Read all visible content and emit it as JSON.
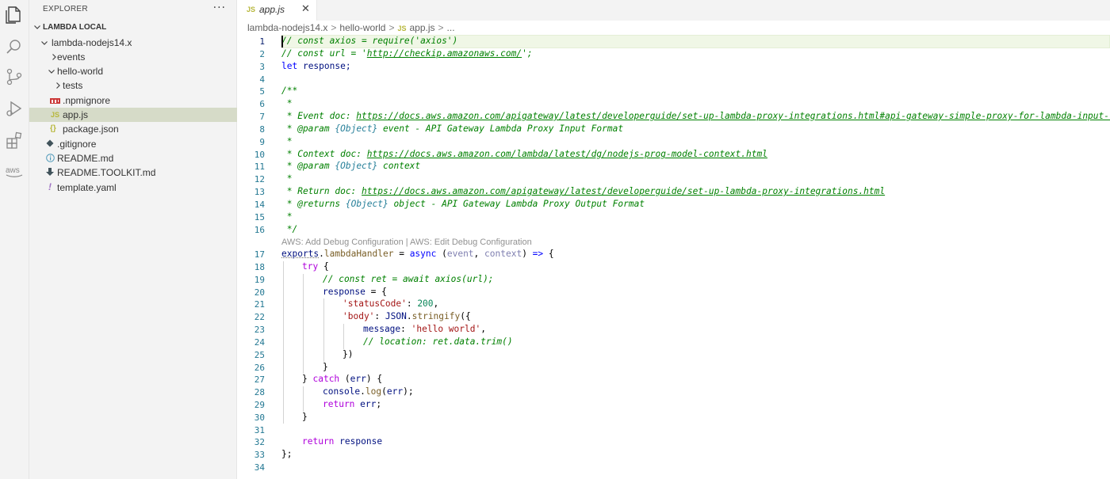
{
  "explorer": {
    "title": "EXPLORER",
    "more_label": "···",
    "section": "LAMBDA LOCAL",
    "tree": [
      {
        "label": "lambda-nodejs14.x",
        "kind": "folder-open"
      },
      {
        "label": "events",
        "kind": "folder-closed"
      },
      {
        "label": "hello-world",
        "kind": "folder-open"
      },
      {
        "label": "tests",
        "kind": "folder-closed"
      },
      {
        "label": ".npmignore",
        "kind": "file",
        "icon": "npm-icon"
      },
      {
        "label": "app.js",
        "kind": "file",
        "icon": "js-icon",
        "selected": true
      },
      {
        "label": "package.json",
        "kind": "file",
        "icon": "json-icon"
      },
      {
        "label": ".gitignore",
        "kind": "file",
        "icon": "git-icon"
      },
      {
        "label": "README.md",
        "kind": "file",
        "icon": "info-icon"
      },
      {
        "label": "README.TOOLKIT.md",
        "kind": "file",
        "icon": "download-icon"
      },
      {
        "label": "template.yaml",
        "kind": "file",
        "icon": "exclamation-icon"
      }
    ]
  },
  "tab": {
    "label": "app.js",
    "js_badge": "JS",
    "close": "✕"
  },
  "breadcrumb": {
    "items": [
      "lambda-nodejs14.x",
      "hello-world",
      "app.js",
      "..."
    ],
    "js_badge": "JS",
    "separator": ">"
  },
  "editor": {
    "line_numbers": [
      "1",
      "2",
      "3",
      "4",
      "5",
      "6",
      "7",
      "8",
      "9",
      "10",
      "11",
      "12",
      "13",
      "14",
      "15",
      "16",
      "17",
      "18",
      "19",
      "20",
      "21",
      "22",
      "23",
      "24",
      "25",
      "26",
      "27",
      "28",
      "29",
      "30",
      "31",
      "32",
      "33",
      "34"
    ],
    "codelens": "AWS: Add Debug Configuration | AWS: Edit Debug Configuration",
    "lines": {
      "l1": "// const axios = require('axios')",
      "l2a": "// const url = '",
      "l2url": "http://checkip.amazonaws.com/",
      "l2b": "';",
      "l3_kw": "let",
      "l3_rest": " response;",
      "l5": "/**",
      "l6": " *",
      "l7a": " * Event doc: ",
      "l7url": "https://docs.aws.amazon.com/apigateway/latest/developerguide/set-up-lambda-proxy-integrations.html#api-gateway-simple-proxy-for-lambda-input-format",
      "l8tag": " * @param",
      "l8type": "{Object}",
      "l8rest": " event - API Gateway Lambda Proxy Input Format",
      "l9": " *",
      "l10a": " * Context doc: ",
      "l10url": "https://docs.aws.amazon.com/lambda/latest/dg/nodejs-prog-model-context.html",
      "l11tag": " * @param",
      "l11type": "{Object}",
      "l11rest": " context",
      "l12": " *",
      "l13a": " * Return doc: ",
      "l13url": "https://docs.aws.amazon.com/apigateway/latest/developerguide/set-up-lambda-proxy-integrations.html",
      "l14tag": " * @returns",
      "l14type": "{Object}",
      "l14rest": " object - API Gateway Lambda Proxy Output Format",
      "l15": " *",
      "l16": " */",
      "l17_exports": "exports",
      "l17_dot": ".",
      "l17_fn": "lambdaHandler",
      "l17_eq": " = ",
      "l17_async": "async",
      "l17_open": " (",
      "l17_p1": "event",
      "l17_comma": ", ",
      "l17_p2": "context",
      "l17_close": ") ",
      "l17_arrow": "=>",
      "l17_brace": " {",
      "l18_try": "try",
      "l18_rest": " {",
      "l19": "// const ret = await axios(url);",
      "l20_var": "response",
      "l20_rest": " = {",
      "l21_key": "'statusCode'",
      "l21_colon": ": ",
      "l21_num": "200",
      "l21_end": ",",
      "l22_key": "'body'",
      "l22_colon": ": ",
      "l22_obj": "JSON",
      "l22_dot": ".",
      "l22_fn": "stringify",
      "l22_end": "({",
      "l23_key": "message",
      "l23_colon": ": ",
      "l23_str": "'hello world'",
      "l23_end": ",",
      "l24": "// location: ret.data.trim()",
      "l25": "})",
      "l26": "}",
      "l27_a": "} ",
      "l27_catch": "catch",
      "l27_b": " (",
      "l27_err": "err",
      "l27_c": ") {",
      "l28_obj": "console",
      "l28_dot": ".",
      "l28_fn": "log",
      "l28_a": "(",
      "l28_err": "err",
      "l28_b": ");",
      "l29_kw": "return",
      "l29_sp": " ",
      "l29_err": "err",
      "l29_end": ";",
      "l30": "}",
      "l32_kw": "return",
      "l32_sp": " ",
      "l32_var": "response",
      "l33": "};"
    }
  },
  "colors": {
    "comment": "#008000",
    "keyword": "#0000ff",
    "control": "#af00db",
    "string": "#a31515",
    "number": "#098658",
    "variable": "#001080",
    "function": "#795e26",
    "selected_row": "#d6dbc8"
  }
}
